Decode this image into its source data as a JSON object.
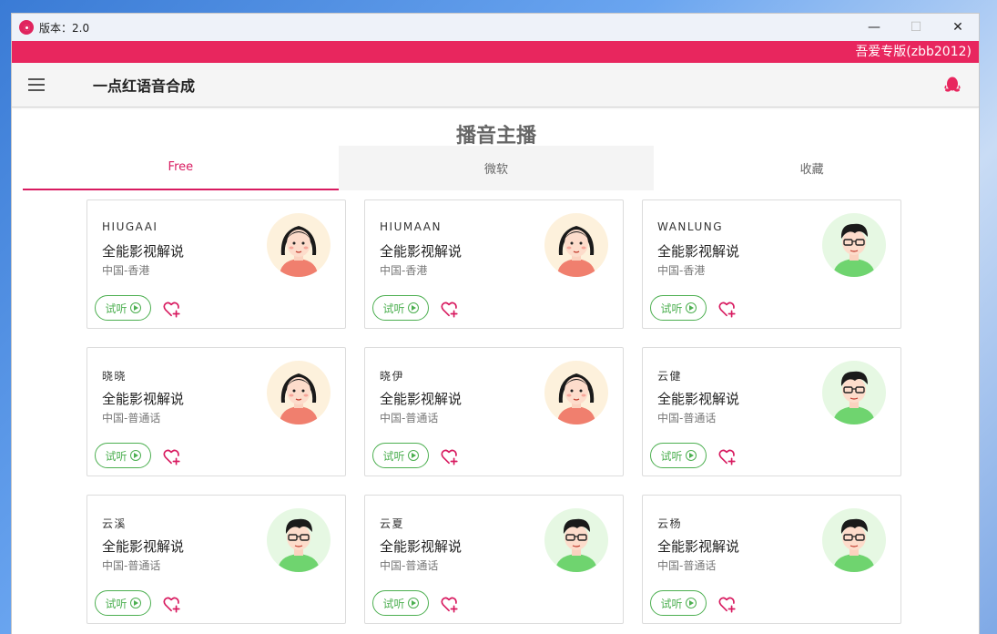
{
  "window": {
    "title": "版本：2.0",
    "minimize": "—",
    "maximize": "☐",
    "close": "✕"
  },
  "banner": {
    "text": "吾爱专版(zbb2012)"
  },
  "appbar": {
    "title": "一点红语音合成"
  },
  "section": {
    "title": "播音主播"
  },
  "tabs": [
    {
      "label": "Free",
      "active": true
    },
    {
      "label": "微软",
      "active": false
    },
    {
      "label": "收藏",
      "active": false
    }
  ],
  "colors": {
    "accent": "#e8265e",
    "tab_active": "#d81b60",
    "listen": "#4caf50",
    "favorite": "#d81b60"
  },
  "cards": [
    {
      "code": "HIUGAAI",
      "style": "全能影视解说",
      "region": "中国-香港",
      "avatar": "female",
      "listen": "试听"
    },
    {
      "code": "HIUMAAN",
      "style": "全能影视解说",
      "region": "中国-香港",
      "avatar": "female",
      "listen": "试听"
    },
    {
      "code": "WANLUNG",
      "style": "全能影视解说",
      "region": "中国-香港",
      "avatar": "male",
      "listen": "试听"
    },
    {
      "code": "晓晓",
      "style": "全能影视解说",
      "region": "中国-普通话",
      "avatar": "female",
      "listen": "试听"
    },
    {
      "code": "晓伊",
      "style": "全能影视解说",
      "region": "中国-普通话",
      "avatar": "female",
      "listen": "试听"
    },
    {
      "code": "云健",
      "style": "全能影视解说",
      "region": "中国-普通话",
      "avatar": "male",
      "listen": "试听"
    },
    {
      "code": "云溪",
      "style": "全能影视解说",
      "region": "中国-普通话",
      "avatar": "male",
      "listen": "试听"
    },
    {
      "code": "云夏",
      "style": "全能影视解说",
      "region": "中国-普通话",
      "avatar": "male",
      "listen": "试听"
    },
    {
      "code": "云杨",
      "style": "全能影视解说",
      "region": "中国-普通话",
      "avatar": "male",
      "listen": "试听"
    }
  ]
}
